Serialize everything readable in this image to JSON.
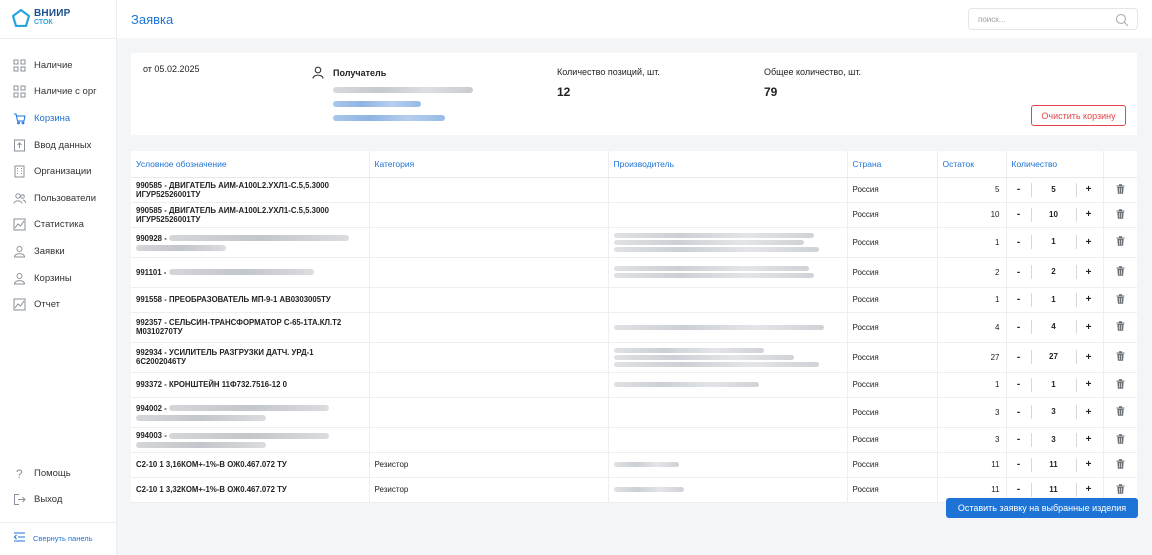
{
  "logo": {
    "line1": "ВНИИР",
    "line2": "СТОК"
  },
  "sidebar": {
    "items": [
      {
        "label": "Наличие",
        "icon": "grid-icon"
      },
      {
        "label": "Наличие с орг",
        "icon": "grid-icon"
      },
      {
        "label": "Корзина",
        "icon": "cart-icon",
        "active": true
      },
      {
        "label": "Ввод данных",
        "icon": "upload-icon"
      },
      {
        "label": "Организации",
        "icon": "building-icon"
      },
      {
        "label": "Пользователи",
        "icon": "users-icon"
      },
      {
        "label": "Статистика",
        "icon": "chart-icon"
      },
      {
        "label": "Заявки",
        "icon": "user-icon"
      },
      {
        "label": "Корзины",
        "icon": "user-icon"
      },
      {
        "label": "Отчет",
        "icon": "chart-icon"
      }
    ],
    "bottom_items": [
      {
        "label": "Помощь",
        "icon": "help-icon"
      },
      {
        "label": "Выход",
        "icon": "logout-icon"
      }
    ],
    "collapse_label": "Свернуть панель"
  },
  "header": {
    "title": "Заявка",
    "search_placeholder": "поиск..."
  },
  "order": {
    "date": "от 05.02.2025",
    "recipient_title": "Получатель",
    "positions_label": "Количество позиций, шт.",
    "positions_value": "12",
    "total_label": "Общее количество, шт.",
    "total_value": "79",
    "clear_label": "Очистить корзину"
  },
  "table": {
    "headers": [
      "Условное обозначение",
      "Категория",
      "Производитель",
      "Страна",
      "Остаток",
      "Количество"
    ],
    "rows": [
      {
        "code": "990585",
        "name": "ДВИГАТЕЛЬ АИМ-А100L2.УХЛ1-С.5,5.3000 ИГУР52526001ТУ",
        "category": "",
        "country": "Россия",
        "stock": "5",
        "qty": "5"
      },
      {
        "code": "990585",
        "name": "ДВИГАТЕЛЬ АИМ-А100L2.УХЛ1-С.5,5.3000 ИГУР52526001ТУ",
        "category": "",
        "country": "Россия",
        "stock": "10",
        "qty": "10"
      },
      {
        "code": "990928",
        "name": "",
        "category": "",
        "country": "Россия",
        "stock": "1",
        "qty": "1"
      },
      {
        "code": "991101",
        "name": "",
        "category": "",
        "country": "Россия",
        "stock": "2",
        "qty": "2"
      },
      {
        "code": "991558",
        "name": "ПРЕОБРАЗОВАТЕЛЬ МП-9-1 АВ0303005ТУ",
        "category": "",
        "country": "Россия",
        "stock": "1",
        "qty": "1"
      },
      {
        "code": "992357",
        "name": "СЕЛЬСИН-ТРАНСФОРМАТОР С-65-1ТА.КЛ.Т2 М0310270ТУ",
        "category": "",
        "country": "Россия",
        "stock": "4",
        "qty": "4"
      },
      {
        "code": "992934",
        "name": "УСИЛИТЕЛЬ РАЗГРУЗКИ ДАТЧ. УРД-1 6С2002046ТУ",
        "category": "",
        "country": "Россия",
        "stock": "27",
        "qty": "27"
      },
      {
        "code": "993372",
        "name": "КРОНШТЕЙН 11Ф732.7516-12 0",
        "category": "",
        "country": "Россия",
        "stock": "1",
        "qty": "1"
      },
      {
        "code": "994002",
        "name": "",
        "category": "",
        "country": "Россия",
        "stock": "3",
        "qty": "3"
      },
      {
        "code": "994003",
        "name": "",
        "category": "",
        "country": "Россия",
        "stock": "3",
        "qty": "3"
      },
      {
        "code": "",
        "name": "С2-10 1 3,16КОМ+-1%-В ОЖ0.467.072 ТУ",
        "category": "Резистор",
        "country": "Россия",
        "stock": "11",
        "qty": "11"
      },
      {
        "code": "",
        "name": "С2-10 1 3,32КОМ+-1%-В ОЖ0.467.072 ТУ",
        "category": "Резистор",
        "country": "Россия",
        "stock": "11",
        "qty": "11"
      }
    ]
  },
  "submit_label": "Оставить заявку на выбранные изделия",
  "colors": {
    "accent": "#1d73d6",
    "danger": "#e0454a"
  }
}
